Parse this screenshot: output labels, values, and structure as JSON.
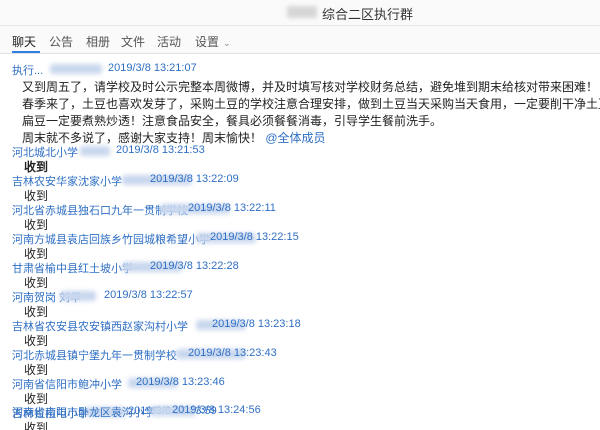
{
  "window": {
    "title": "综合二区执行群"
  },
  "tabs": [
    {
      "label": "聊天"
    },
    {
      "label": "公告"
    },
    {
      "label": "相册"
    },
    {
      "label": "文件"
    },
    {
      "label": "活动"
    },
    {
      "label": "设置"
    }
  ],
  "messages": {
    "announcement": {
      "sender": "执行...",
      "time": "2019/3/8 13:21:07",
      "lines": [
        "又到周五了，请学校及时公示完整本周微博，并及时填写核对学校财务总结，避免堆到期末给核对带来困难！",
        "春季来了，土豆也喜欢发芽了，采购土豆的学校注意合理安排，做到土豆当天采购当天食用，一定要削干净土豆皮；不允许食用发芽的土豆。",
        "扁豆一定要煮熟炒透！注意食品安全，餐具必须餐餐消毒，引导学生餐前洗手。",
        "周末就不多说了，感谢大家支持！周末愉快！"
      ],
      "mention": "@全体成员"
    },
    "replies": [
      {
        "sender": "河北城北小学",
        "time": "2019/3/8 13:21:53",
        "text": "收到"
      },
      {
        "sender": "吉林农安华家沈家小学",
        "time": "2019/3/8 13:22:09",
        "text": "收到"
      },
      {
        "sender": "河北省赤城县独石口九年一贯制学校",
        "time": "2019/3/8 13:22:11",
        "text": "收到"
      },
      {
        "sender": "河南方城县袁店回族乡竹园城粮希望小学",
        "time": "2019/3/8 13:22:15",
        "text": "收到"
      },
      {
        "sender": "甘肃省榆中县红土坡小学~",
        "time": "2019/3/8 13:22:28",
        "text": "收到"
      },
      {
        "sender": "河南贺岗 刘华",
        "time": "2019/3/8 13:22:57",
        "text": "收到"
      },
      {
        "sender": "吉林省农安县农安镇西赵家沟村小学",
        "time": "2019/3/8 13:23:18",
        "text": "收到"
      },
      {
        "sender": "河北赤城县镇宁堡九年一贯制学校",
        "time": "2019/3/8 13:23:43",
        "text": "收到"
      },
      {
        "sender": "河南省信阳市鲍冲小学",
        "time": "2019/3/8 13:23:46",
        "text": "收到"
      },
      {
        "sender": "吉林拉拉屯小学",
        "time": "2019/3/8 13:23:59",
        "text": "收到"
      },
      {
        "sender": "河南省南阳市卧龙区袁沟小学",
        "time": "2019/3/8 13:24:56",
        "text": ""
      }
    ]
  }
}
